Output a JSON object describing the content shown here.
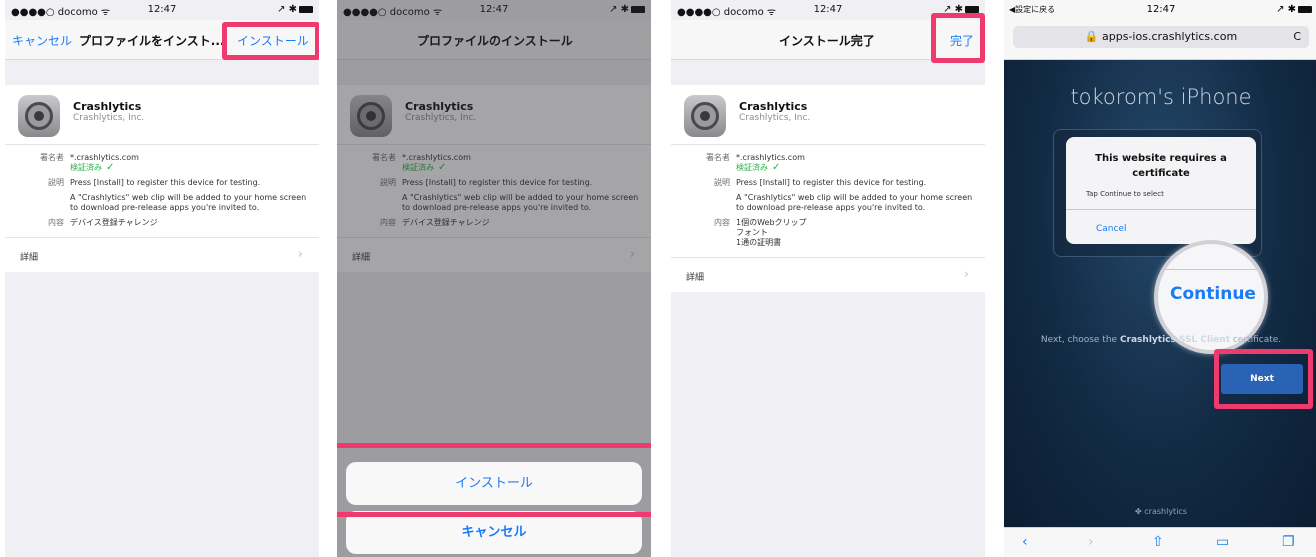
{
  "status": {
    "carrier": "●●●●○ docomo ᯤ",
    "time": "12:47",
    "indicators": "↗ ✱",
    "back_label": "◀設定に戻る"
  },
  "screen1": {
    "nav_left": "キャンセル",
    "nav_title": "プロファイルをインスト...",
    "nav_right": "インストール"
  },
  "screen2": {
    "nav_title": "プロファイルのインストール",
    "install_button": "インストール",
    "cancel_button": "キャンセル"
  },
  "screen3": {
    "nav_title": "インストール完了",
    "nav_right": "完了"
  },
  "profile": {
    "app_name": "Crashlytics",
    "company": "Crashlytics, Inc.",
    "signer_label": "署名者",
    "signer_value": "*.crashlytics.com",
    "verified": "検証済み",
    "desc_label": "説明",
    "desc_1": "Press [Install] to register this device for testing.",
    "desc_2": "A \"Crashlytics\" web clip will be added to your home screen to download pre-release apps you're invited to.",
    "contents_label": "内容",
    "contents_value": "デバイス登録チャレンジ",
    "contents_line1": "1個のWebクリップ",
    "contents_line2": "フォント",
    "contents_line3": "1通の証明書",
    "more_label": "詳細"
  },
  "safari": {
    "url": "🔒 apps-ios.crashlytics.com",
    "reload": "C",
    "device_name": "tokorom's iPhone",
    "alert_title": "This website requires a certificate",
    "alert_message": "Tap Continue to select",
    "alert_cancel": "Cancel",
    "alert_continue": "Continue",
    "instruction_pre": "Next, choose the ",
    "instruction_bold": "Crashlytics SSL Client",
    "instruction_post": " certificate.",
    "next_button": "Next",
    "footer": "crashlytics",
    "toolbar": {
      "back": "‹",
      "forward": "›",
      "share": "⇧",
      "bookmarks": "▭",
      "tabs": "❐"
    }
  },
  "colors": {
    "accent": "#1a7cf5",
    "highlight": "#f03a6e",
    "verified": "#2bb24c"
  }
}
